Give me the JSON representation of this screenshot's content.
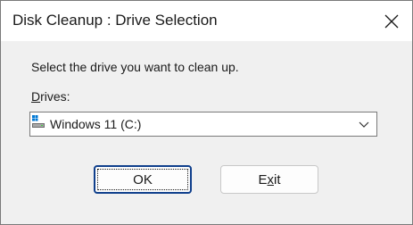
{
  "window": {
    "title": "Disk Cleanup : Drive Selection",
    "close_icon": "close-icon"
  },
  "main": {
    "prompt": "Select the drive you want to clean up.",
    "drives_label_mnemonic": "D",
    "drives_label_rest": "rives:",
    "drive_select": {
      "value": "Windows 11 (C:)",
      "icon": "windows-drive-icon",
      "chevron_icon": "chevron-down-icon"
    }
  },
  "buttons": {
    "ok_label": "OK",
    "exit_mnemonic": "x",
    "exit_pre": "E",
    "exit_post": "it"
  },
  "colors": {
    "window_bg": "#f0f0f0",
    "titlebar_bg": "#ffffff",
    "default_button_border": "#0f3f8c"
  }
}
